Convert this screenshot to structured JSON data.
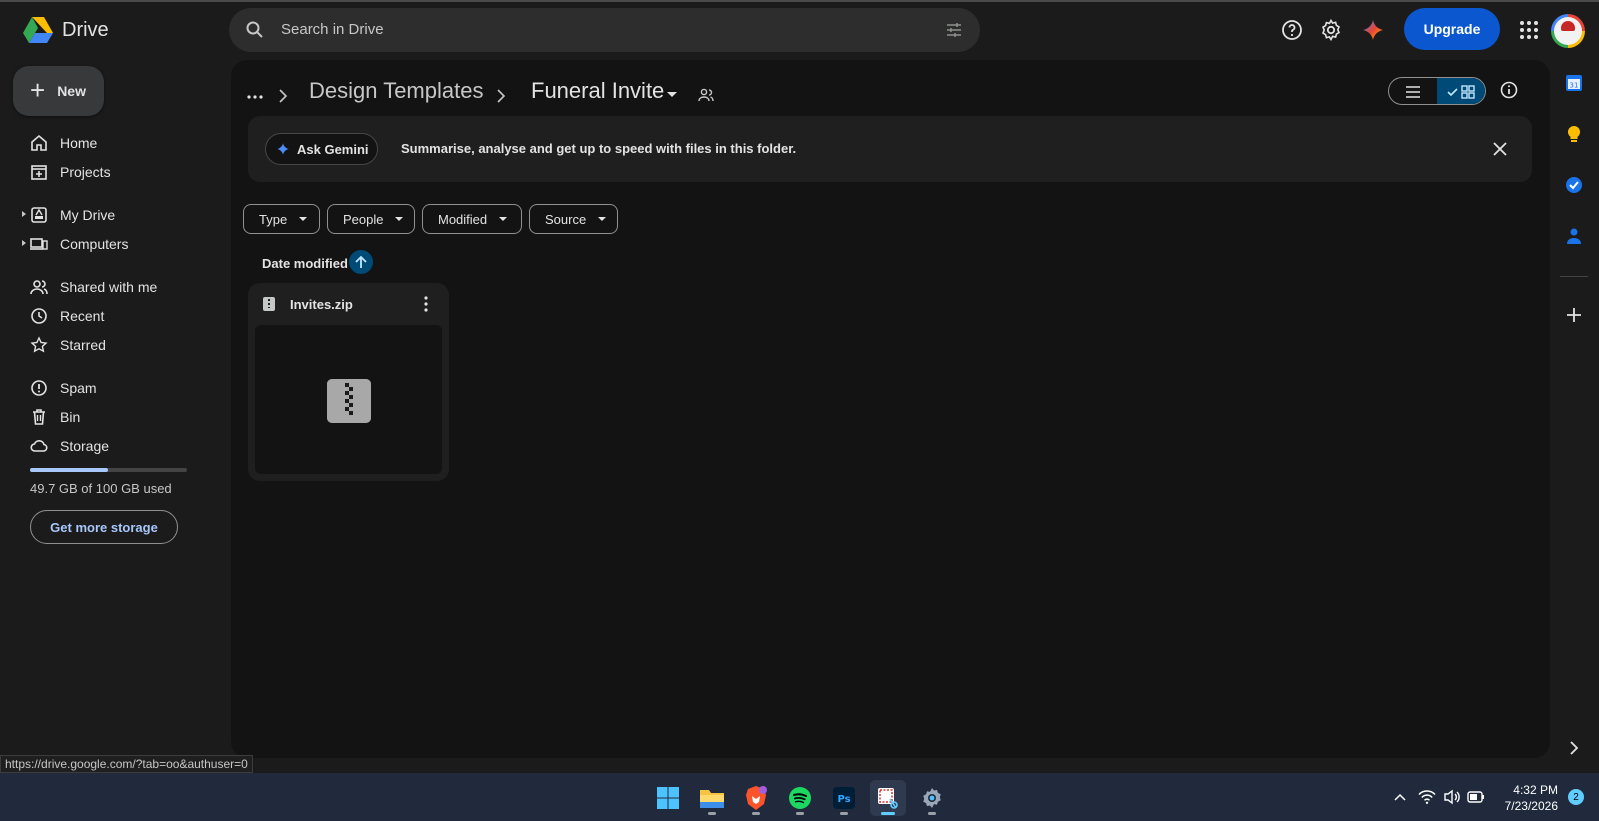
{
  "app": {
    "title": "Drive"
  },
  "search": {
    "placeholder": "Search in Drive"
  },
  "header": {
    "upgrade_label": "Upgrade"
  },
  "sidebar": {
    "new_label": "New",
    "items": [
      {
        "label": "Home",
        "icon": "home-icon"
      },
      {
        "label": "Projects",
        "icon": "projects-icon"
      },
      {
        "label": "My Drive",
        "icon": "my-drive-icon"
      },
      {
        "label": "Computers",
        "icon": "computers-icon"
      },
      {
        "label": "Shared with me",
        "icon": "shared-icon"
      },
      {
        "label": "Recent",
        "icon": "clock-icon"
      },
      {
        "label": "Starred",
        "icon": "star-icon"
      },
      {
        "label": "Spam",
        "icon": "spam-icon"
      },
      {
        "label": "Bin",
        "icon": "bin-icon"
      },
      {
        "label": "Storage",
        "icon": "cloud-icon"
      }
    ],
    "storage_used_fraction": 0.497,
    "storage_text": "49.7 GB of 100 GB used",
    "get_storage_label": "Get more storage"
  },
  "breadcrumb": {
    "parent": "Design Templates",
    "current": "Funeral Invite"
  },
  "gemini": {
    "button_label": "Ask Gemini",
    "message": "Summarise, analyse and get up to speed with files in this folder."
  },
  "filters": [
    "Type",
    "People",
    "Modified",
    "Source"
  ],
  "sort": {
    "label": "Date modified",
    "direction": "ascending"
  },
  "files": [
    {
      "name": "Invites.zip",
      "type": "zip"
    }
  ],
  "status_bar": {
    "url": "https://drive.google.com/?tab=oo&authuser=0"
  },
  "taskbar": {
    "time": "4:32 PM",
    "date": "7/23/2026",
    "notifications": "2"
  },
  "colors": {
    "accent": "#0b57d0",
    "selected": "#004a77",
    "link": "#a8c7fa",
    "background": "#131313"
  }
}
